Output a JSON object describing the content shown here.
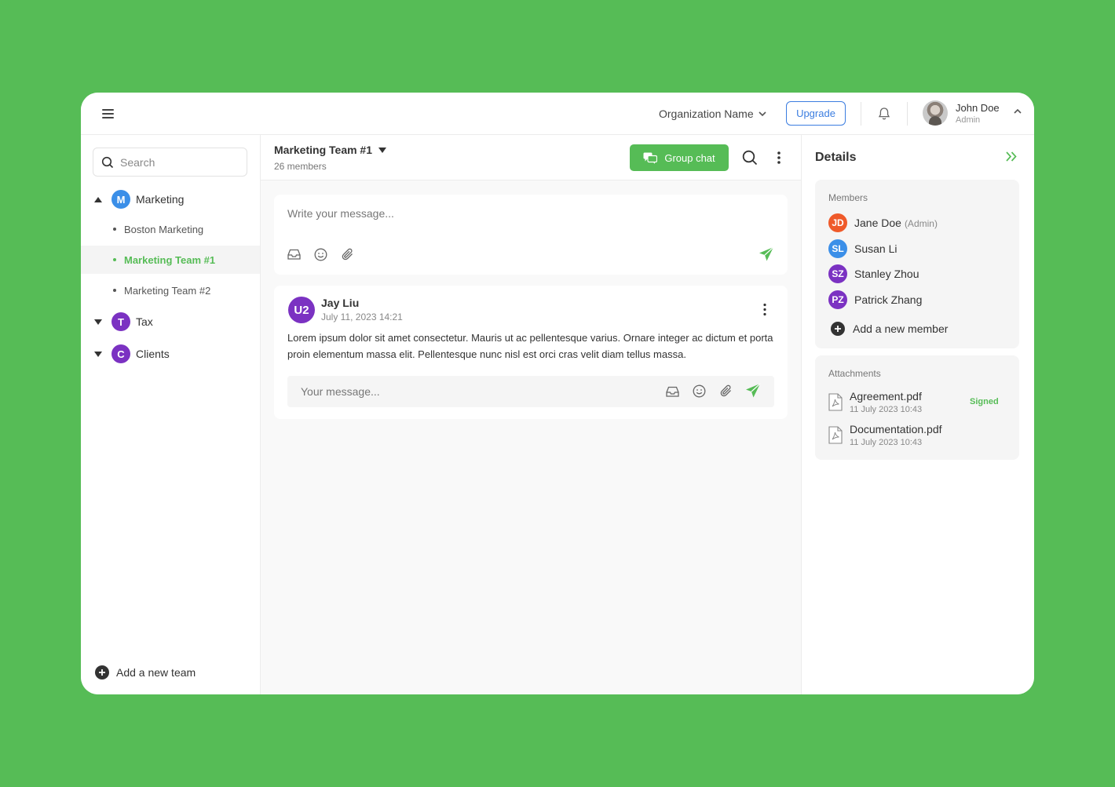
{
  "topbar": {
    "org_name": "Organization Name",
    "upgrade_label": "Upgrade",
    "user_name": "John Doe",
    "user_role": "Admin"
  },
  "sidebar": {
    "search_placeholder": "Search",
    "groups": [
      {
        "initial": "M",
        "label": "Marketing",
        "color": "#3b8fe8",
        "expanded": true
      },
      {
        "initial": "T",
        "label": "Tax",
        "color": "#7b32c2",
        "expanded": false
      },
      {
        "initial": "C",
        "label": "Clients",
        "color": "#7b32c2",
        "expanded": false
      }
    ],
    "sub_items": [
      "Boston Marketing",
      "Marketing Team #1",
      "Marketing Team #2"
    ],
    "active_sub_item": "Marketing Team #1",
    "add_team_label": "Add a new team"
  },
  "chat": {
    "team_name": "Marketing Team #1",
    "member_count": "26 members",
    "group_chat_label": "Group chat",
    "compose_placeholder": "Write your message...",
    "message": {
      "avatar_initials": "U2",
      "author": "Jay Liu",
      "timestamp": "July 11, 2023 14:21",
      "body": "Lorem ipsum dolor sit amet consectetur. Mauris ut ac pellentesque varius. Ornare integer ac dictum et porta proin elementum massa elit. Pellentesque nunc nisl est orci cras velit diam tellus massa.",
      "reply_placeholder": "Your message..."
    }
  },
  "details": {
    "title": "Details",
    "members_title": "Members",
    "members": [
      {
        "initials": "JD",
        "name": "Jane Doe",
        "suffix": "(Admin)",
        "color": "#ef5a2a"
      },
      {
        "initials": "SL",
        "name": "Susan Li",
        "suffix": "",
        "color": "#3b8fe8"
      },
      {
        "initials": "SZ",
        "name": "Stanley Zhou",
        "suffix": "",
        "color": "#7b32c2"
      },
      {
        "initials": "PZ",
        "name": "Patrick Zhang",
        "suffix": "",
        "color": "#7b32c2"
      }
    ],
    "add_member_label": "Add a new member",
    "attachments_title": "Attachments",
    "attachments": [
      {
        "name": "Agreement.pdf",
        "date": "11 July 2023 10:43",
        "status": "Signed"
      },
      {
        "name": "Documentation.pdf",
        "date": "11 July 2023 10:43",
        "status": ""
      }
    ]
  },
  "colors": {
    "background": "#56BC56",
    "accent": "#56BC56",
    "upgrade": "#3b7de0"
  }
}
